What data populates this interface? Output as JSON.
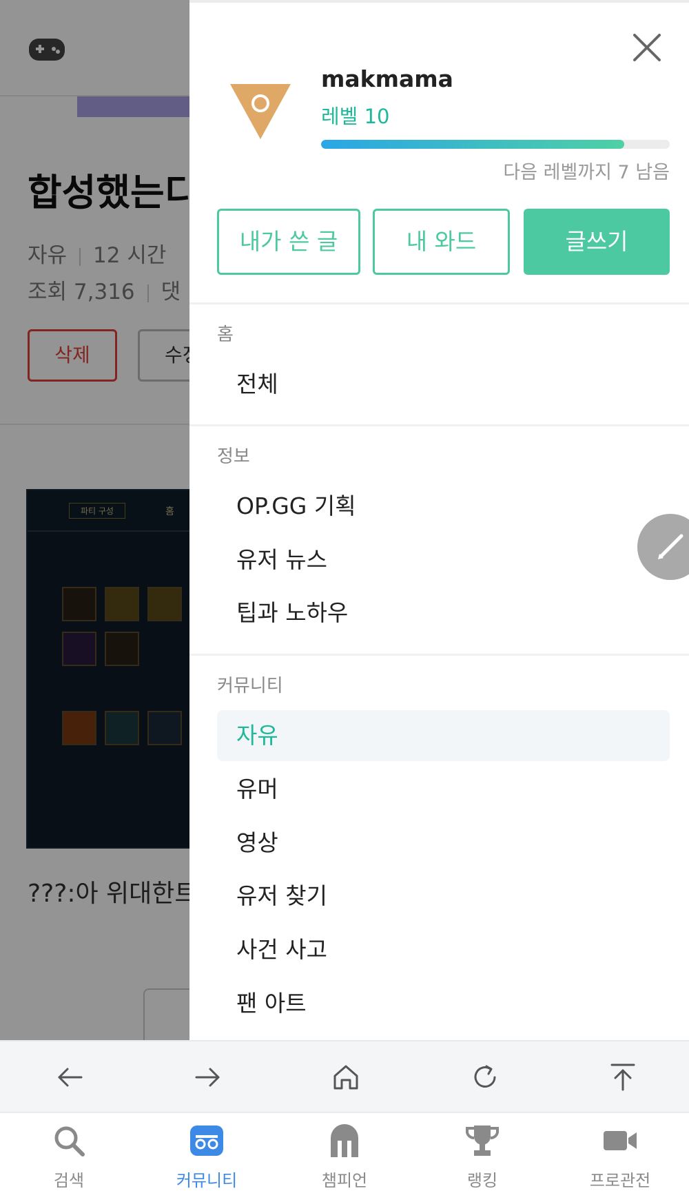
{
  "background": {
    "post_title": "합성했는디",
    "category": "자유",
    "time_ago": "12 시간",
    "views": "조회 7,316",
    "comments_label": "댓",
    "delete_label": "삭제",
    "edit_label": "수정",
    "caption": "???:아 위대한트",
    "shot_tab_label": "파티 구성",
    "shot_home": "홈"
  },
  "drawer": {
    "username": "makmama",
    "level": "레벨 10",
    "progress_percent": 87,
    "progress_caption": "다음 레벨까지 7 남음",
    "buttons": {
      "my_posts": "내가 쓴 글",
      "my_wards": "내 와드",
      "write": "글쓰기"
    },
    "sections": {
      "home": {
        "title": "홈",
        "items": [
          "전체"
        ]
      },
      "info": {
        "title": "정보",
        "items": [
          "OP.GG 기획",
          "유저 뉴스",
          "팁과 노하우"
        ]
      },
      "community": {
        "title": "커뮤니티",
        "active_index": 0,
        "items": [
          "자유",
          "유머",
          "영상",
          "유저 찾기",
          "사건 사고",
          "팬 아트"
        ]
      }
    }
  },
  "browser_nav": [
    "back-icon",
    "forward-icon",
    "home-icon",
    "reload-icon",
    "scroll-top-icon"
  ],
  "tabs": [
    {
      "label": "검색",
      "icon": "search-icon",
      "active": false
    },
    {
      "label": "커뮤니티",
      "icon": "community-icon",
      "active": true
    },
    {
      "label": "챔피언",
      "icon": "champion-icon",
      "active": false
    },
    {
      "label": "랭킹",
      "icon": "trophy-icon",
      "active": false
    },
    {
      "label": "프로관전",
      "icon": "video-camera-icon",
      "active": false
    }
  ],
  "colors": {
    "accent": "#4cc9a0",
    "accent_text": "#1fb89a",
    "tab_active": "#3d8ae6",
    "delete_red": "#e0403a"
  }
}
